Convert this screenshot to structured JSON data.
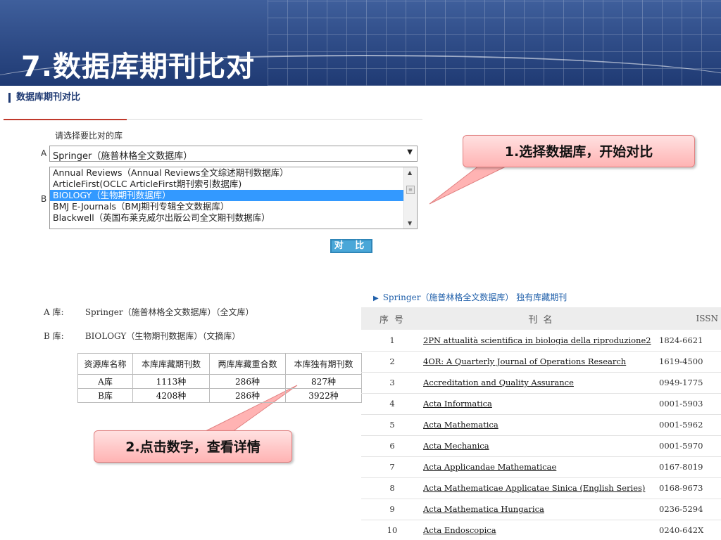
{
  "slide_title": "7.数据库期刊比对",
  "sub_title": "数据库期刊对比",
  "form": {
    "prompt": "请选择要比对的库",
    "label_a": "A",
    "label_b": "B",
    "select_a_value": "Springer（施普林格全文数据库）",
    "list_b_options": [
      "Annual Reviews（Annual Reviews全文综述期刊数据库）",
      "ArticleFirst(OCLC ArticleFirst期刊索引数据库)",
      "BIOLOGY（生物期刊数据库）",
      "BMJ E-Journals（BMJ期刊专辑全文数据库）",
      "Blackwell（英国布莱克威尔出版公司全文期刊数据库）"
    ],
    "list_b_selected": "BIOLOGY（生物期刊数据库）",
    "compare_button": "对 比"
  },
  "callouts": {
    "step1": "1.选择数据库，开始对比",
    "step2": "2.点击数字，查看详情"
  },
  "comparison": {
    "a_key": "A 库:",
    "a_value": "Springer（施普林格全文数据库）（全文库）",
    "b_key": "B 库:",
    "b_value": "BIOLOGY（生物期刊数据库）（文摘库）",
    "headers": [
      "资源库名称",
      "本库库藏期刊数",
      "两库库藏重合数",
      "本库独有期刊数"
    ],
    "rows": [
      [
        "A库",
        "1113种",
        "286种",
        "827种"
      ],
      [
        "B库",
        "4208种",
        "286种",
        "3922种"
      ]
    ]
  },
  "results": {
    "heading": "Springer（施普林格全文数据库） 独有库藏期刊",
    "headers": [
      "序 号",
      "刊 名",
      "ISSN"
    ],
    "rows": [
      [
        "1",
        "2PN attualità scientifica in biologia della riproduzione2",
        "1824-6621"
      ],
      [
        "2",
        "4OR: A Quarterly Journal of Operations Research",
        "1619-4500"
      ],
      [
        "3",
        "Accreditation and Quality Assurance",
        "0949-1775"
      ],
      [
        "4",
        "Acta Informatica",
        "0001-5903"
      ],
      [
        "5",
        "Acta Mathematica",
        "0001-5962"
      ],
      [
        "6",
        "Acta Mechanica",
        "0001-5970"
      ],
      [
        "7",
        "Acta Applicandae Mathematicae",
        "0167-8019"
      ],
      [
        "8",
        "Acta Mathematicae Applicatae Sinica (English Series)",
        "0168-9673"
      ],
      [
        "9",
        "Acta Mathematica Hungarica",
        "0236-5294"
      ],
      [
        "10",
        "Acta Endoscopica",
        "0240-642X"
      ]
    ]
  },
  "colors": {
    "banner": "#2d4a85",
    "selection": "#3399ff",
    "button": "#4aa7d8",
    "callout": "#ffb3b3",
    "link_heading": "#1f5faa"
  }
}
